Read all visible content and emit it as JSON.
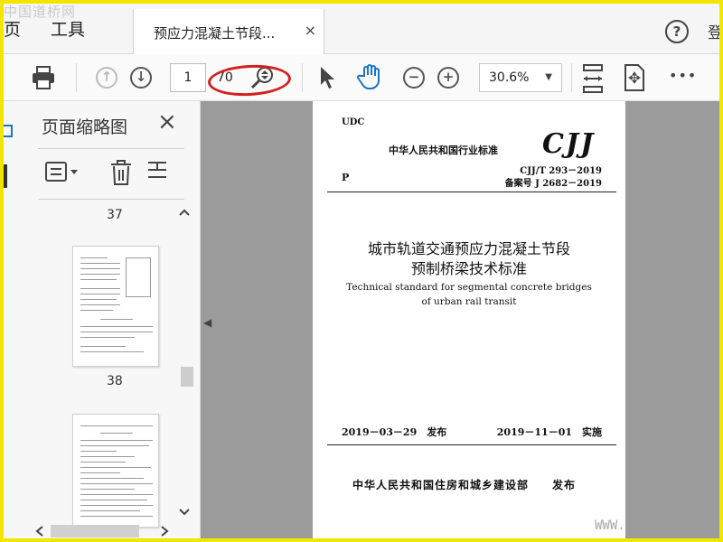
{
  "menu": {
    "home": "页",
    "tools": "工具"
  },
  "tab": {
    "title": "预应力混凝土节段...",
    "close": "×"
  },
  "header": {
    "help": "?",
    "login": "登"
  },
  "watermark": {
    "top_left": "中国道桥网",
    "bottom_right": "WWW."
  },
  "toolbar": {
    "page_current": "1",
    "page_total": "70",
    "zoom": "30.6%",
    "more": "•••",
    "highlight_color": "#d32020"
  },
  "sidebar": {
    "title": "页面缩略图",
    "close": "×",
    "thumbs": [
      {
        "label": "37"
      },
      {
        "label": "38"
      }
    ]
  },
  "document": {
    "udc": "UDC",
    "standard_header": "中华人民共和国行业标准",
    "logo": "CJJ",
    "p": "P",
    "code1": "CJJ/T 293－2019",
    "code2": "备案号 J 2682－2019",
    "title_cn_1": "城市轨道交通预应力混凝土节段",
    "title_cn_2": "预制桥梁技术标准",
    "title_en_1": "Technical standard for segmental concrete bridges",
    "title_en_2": "of urban rail transit",
    "publish_date": "2019－03－29　发布",
    "effective_date": "2019－11－01　实施",
    "publisher": "中华人民共和国住房和城乡建设部　　发布"
  }
}
